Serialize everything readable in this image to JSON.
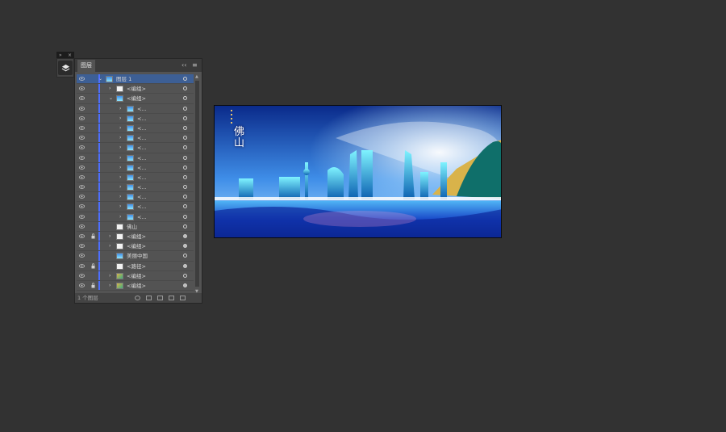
{
  "panel": {
    "tab_label": "图层",
    "footer_count": "1 个图层"
  },
  "layers": [
    {
      "label": "图层 1",
      "selected": true,
      "depth": 0,
      "twisty": "open",
      "locked": false,
      "thumb": "art"
    },
    {
      "label": "<编组>",
      "depth": 1,
      "twisty": "closed",
      "locked": false,
      "thumb": "white"
    },
    {
      "label": "<编组>",
      "depth": 1,
      "twisty": "open",
      "locked": false,
      "thumb": "art"
    },
    {
      "label": "<...",
      "depth": 2,
      "twisty": "closed",
      "locked": false,
      "thumb": "art"
    },
    {
      "label": "<...",
      "depth": 2,
      "twisty": "closed",
      "locked": false,
      "thumb": "art"
    },
    {
      "label": "<...",
      "depth": 2,
      "twisty": "closed",
      "locked": false,
      "thumb": "art"
    },
    {
      "label": "<...",
      "depth": 2,
      "twisty": "closed",
      "locked": false,
      "thumb": "art"
    },
    {
      "label": "<...",
      "depth": 2,
      "twisty": "closed",
      "locked": false,
      "thumb": "art"
    },
    {
      "label": "<...",
      "depth": 2,
      "twisty": "closed",
      "locked": false,
      "thumb": "art"
    },
    {
      "label": "<...",
      "depth": 2,
      "twisty": "closed",
      "locked": false,
      "thumb": "art"
    },
    {
      "label": "<...",
      "depth": 2,
      "twisty": "closed",
      "locked": false,
      "thumb": "art"
    },
    {
      "label": "<...",
      "depth": 2,
      "twisty": "closed",
      "locked": false,
      "thumb": "art"
    },
    {
      "label": "<...",
      "depth": 2,
      "twisty": "closed",
      "locked": false,
      "thumb": "art"
    },
    {
      "label": "<...",
      "depth": 2,
      "twisty": "closed",
      "locked": false,
      "thumb": "art"
    },
    {
      "label": "<...",
      "depth": 2,
      "twisty": "closed",
      "locked": false,
      "thumb": "art"
    },
    {
      "label": "佛山",
      "depth": 1,
      "twisty": "none",
      "locked": false,
      "thumb": "white"
    },
    {
      "label": "<编组>",
      "depth": 1,
      "twisty": "closed",
      "locked": true,
      "thumb": "white"
    },
    {
      "label": "<编组>",
      "depth": 1,
      "twisty": "closed",
      "locked": false,
      "thumb": "white"
    },
    {
      "label": "美丽中国",
      "depth": 1,
      "twisty": "none",
      "locked": false,
      "thumb": "art"
    },
    {
      "label": "<路径>",
      "depth": 1,
      "twisty": "none",
      "locked": true,
      "thumb": "white"
    },
    {
      "label": "<编组>",
      "depth": 1,
      "twisty": "closed",
      "locked": false,
      "thumb": "gold"
    },
    {
      "label": "<编组>",
      "depth": 1,
      "twisty": "closed",
      "locked": true,
      "thumb": "gold"
    }
  ],
  "artwork": {
    "city_name": "佛山",
    "vertical_text": "美丽中国"
  },
  "colors": {
    "layer_color": "#4d6fff",
    "selection": "#3d5f95",
    "sky_top": "#0a2a8a",
    "sky_mid": "#3f8ee8",
    "glow": "#ffffff",
    "water": "#1746c7",
    "gold": "#d9b34a",
    "teal": "#0f6f6a"
  },
  "icons": {
    "eye": "eye-icon",
    "lock": "lock-icon",
    "layers": "layers-icon",
    "collapse": "collapse-icon",
    "menu": "panel-menu-icon"
  }
}
